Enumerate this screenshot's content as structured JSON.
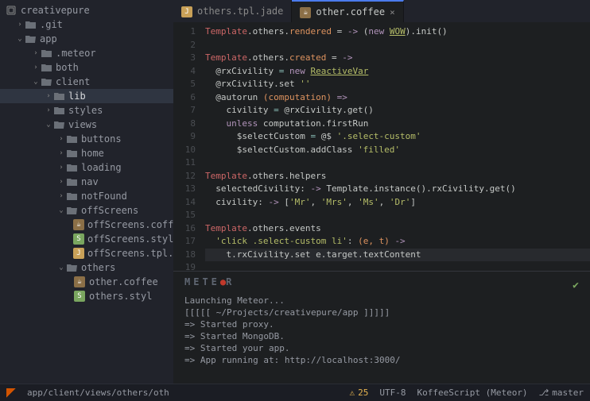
{
  "project": {
    "name": "creativepure"
  },
  "tree": {
    "git": ".git",
    "app": "app",
    "meteor": ".meteor",
    "both": "both",
    "client": "client",
    "lib": "lib",
    "styles": "styles",
    "views": "views",
    "buttons": "buttons",
    "home": "home",
    "loading": "loading",
    "nav": "nav",
    "notFound": "notFound",
    "offScreens": "offScreens",
    "offScreens_coffee": "offScreens.coffee",
    "offScreens_styl": "offScreens.styl",
    "offScreens_jade": "offScreens.tpl.jade",
    "others": "others",
    "other_coffee": "other.coffee",
    "others_styl": "others.styl"
  },
  "tabs": {
    "tab1": "others.tpl.jade",
    "tab2": "other.coffee",
    "close": "×"
  },
  "code": {
    "l1_a": "Template",
    "l1_b": ".others.",
    "l1_c": "rendered",
    "l1_d": " = ",
    "l1_e": "->",
    "l1_f": " (",
    "l1_g": "new",
    "l1_h": " ",
    "l1_wow": "WOW",
    "l1_i": ").init()",
    "l3_a": "Template",
    "l3_b": ".others.",
    "l3_c": "created",
    "l3_d": " = ",
    "l3_e": "->",
    "l4_a": "  @rxCivility ",
    "l4_b": "= ",
    "l4_c": "new",
    "l4_d": " ",
    "l4_rv": "ReactiveVar",
    "l5_a": "  @rxCivility.set ",
    "l5_str": "''",
    "l6_a": "  @autorun ",
    "l6_b": "(computation) ",
    "l6_c": "=>",
    "l7_a": "    civility ",
    "l7_b": "= ",
    "l7_c": "@rxCivility.get()",
    "l8_a": "    ",
    "l8_b": "unless",
    "l8_c": " computation.firstRun",
    "l9_a": "      $selectCustom ",
    "l9_b": "= ",
    "l9_c": "@$ ",
    "l9_str": "'.select-custom'",
    "l10_a": "      $selectCustom.addClass ",
    "l10_str": "'filled'",
    "l12_a": "Template",
    "l12_b": ".others.helpers",
    "l13_a": "  selectedCivility: ",
    "l13_b": "->",
    "l13_c": " Template.instance().rxCivility.get()",
    "l14_a": "  civility: ",
    "l14_b": "->",
    "l14_c": " [",
    "l14_s1": "'Mr'",
    "l14_cm": ", ",
    "l14_s2": "'Mrs'",
    "l14_s3": "'Ms'",
    "l14_s4": "'Dr'",
    "l14_end": "]",
    "l16_a": "Template",
    "l16_b": ".others.events",
    "l17_a": "  ",
    "l17_str": "'click .select-custom li'",
    "l17_b": ": ",
    "l17_c": "(e, t) ",
    "l17_d": "->",
    "l18_a": "    t.rxCivility.set e.target.textContent"
  },
  "lines": {
    "n1": "1",
    "n2": "2",
    "n3": "3",
    "n4": "4",
    "n5": "5",
    "n6": "6",
    "n7": "7",
    "n8": "8",
    "n9": "9",
    "n10": "10",
    "n11": "11",
    "n12": "12",
    "n13": "13",
    "n14": "14",
    "n15": "15",
    "n16": "16",
    "n17": "17",
    "n18": "18",
    "n19": "19"
  },
  "terminal": {
    "brand_a": "METE",
    "brand_b": "R",
    "l1": "Launching Meteor...",
    "l2": "[[[[[ ~/Projects/creativepure/app ]]]]]",
    "l3": "=> Started proxy.",
    "l4": "=> Started MongoDB.",
    "l5": "=> Started your app.",
    "l6": "=> App running at: http://localhost:3000/"
  },
  "status": {
    "path": "app/client/views/others/oth",
    "warn": "25",
    "enc": "UTF-8",
    "lang": "KoffeeScript (Meteor)",
    "branch": "master"
  }
}
